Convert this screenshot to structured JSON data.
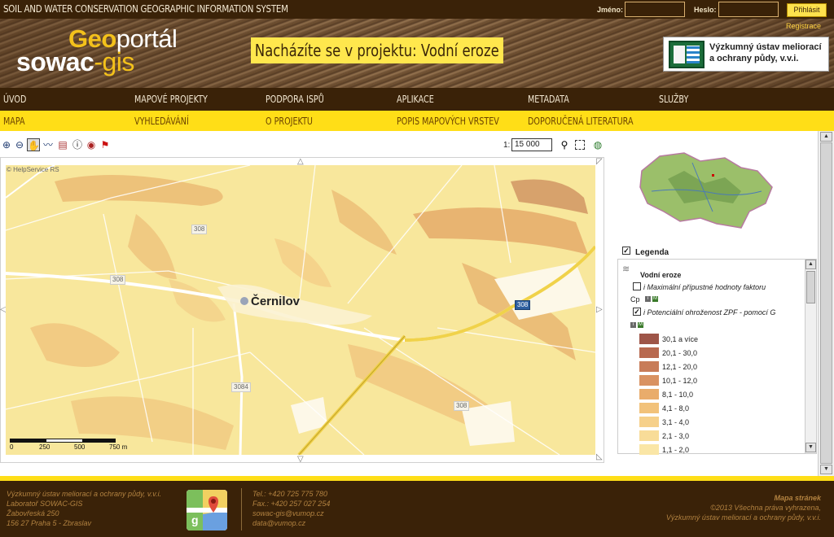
{
  "header": {
    "system_title": "SOIL AND WATER CONSERVATION GEOGRAPHIC INFORMATION SYSTEM",
    "login_name_label": "Jméno:",
    "login_password_label": "Heslo:",
    "login_button": "Přihlásit",
    "register_link": "Registrace"
  },
  "banner": {
    "logo_geo": "Geo",
    "logo_portal": "portál",
    "logo_sowac": "sowac",
    "logo_gis": "-gis",
    "project_text": "Nacházíte se v projektu: Vodní eroze",
    "institute_line1": "Výzkumný ústav meliorací",
    "institute_line2": "a ochrany půdy, v.v.i."
  },
  "main_nav": [
    "ÚVOD",
    "MAPOVÉ PROJEKTY",
    "PODPORA ISPŮ",
    "APLIKACE",
    "METADATA",
    "SLUŽBY"
  ],
  "sub_nav": [
    "MAPA",
    "VYHLEDÁVÁNÍ",
    "O PROJEKTU",
    "POPIS MAPOVÝCH VRSTEV",
    "DOPORUČENÁ LITERATURA"
  ],
  "toolbar": {
    "tools": [
      "zoom-in-icon",
      "zoom-out-icon",
      "pan-hand-icon",
      "measure-icon",
      "print-icon",
      "info-icon",
      "identify-icon",
      "location-pin-icon"
    ],
    "scale_prefix": "1:",
    "scale_value": "15 000"
  },
  "map": {
    "copyright": "© HelpService RS",
    "town": "Černilov",
    "roads": [
      "308",
      "308",
      "308",
      "3084",
      "308"
    ],
    "scale_ticks": [
      "0",
      "250",
      "500",
      "750 m"
    ]
  },
  "legend": {
    "title": "Legenda",
    "group": "Vodní eroze",
    "layer1_line1": "i Maximální přípustné hodnoty faktoru",
    "layer1_line2": "Cp",
    "layer2": "i Potenciální ohroženost ZPF - pomocí G",
    "classes": [
      {
        "label": "30,1 a více",
        "color": "#9e5548"
      },
      {
        "label": "20,1 - 30,0",
        "color": "#b8694f"
      },
      {
        "label": "12,1 - 20,0",
        "color": "#c87c58"
      },
      {
        "label": "10,1 - 12,0",
        "color": "#d99262"
      },
      {
        "label": "8,1 - 10,0",
        "color": "#e9ac6b"
      },
      {
        "label": "4,1 - 8,0",
        "color": "#f2c27a"
      },
      {
        "label": "3,1 - 4,0",
        "color": "#f6d08a"
      },
      {
        "label": "2,1 - 3,0",
        "color": "#f8dc98"
      },
      {
        "label": "1,1 - 2,0",
        "color": "#fae6a6"
      }
    ]
  },
  "footer": {
    "org_line1": "Výzkumný ústav meliorací a ochrany půdy, v.v.i.",
    "org_line2": "Laboratoř SOWAC-GIS",
    "org_line3": "Žabovřeská 250",
    "org_line4": "156 27 Praha 5 - Zbraslav",
    "tel": "Tel.: +420 725 775 780",
    "fax": "Fax.: +420 257 027 254",
    "email1": "sowac-gis@vumop.cz",
    "email2": "data@vumop.cz",
    "sitemap": "Mapa stránek",
    "copyright_line1": "©2013 Všechna práva vyhrazena,",
    "copyright_line2": "Výzkumný ústav meliorací a ochrany půdy, v.v.i."
  }
}
